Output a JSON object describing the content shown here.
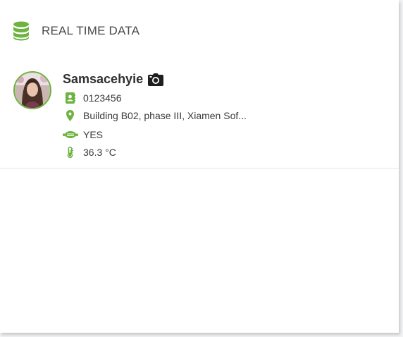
{
  "header": {
    "title": "REAL TIME DATA",
    "icon": "database-icon"
  },
  "record": {
    "name": "Samsacehyie",
    "id_number": "0123456",
    "address": "Building B02, phase III, Xiamen Sof...",
    "mask": "YES",
    "temperature": "36.3 °C"
  },
  "colors": {
    "accent": "#6db33f",
    "text": "#3a3a3a",
    "title": "#4a4a4a"
  }
}
